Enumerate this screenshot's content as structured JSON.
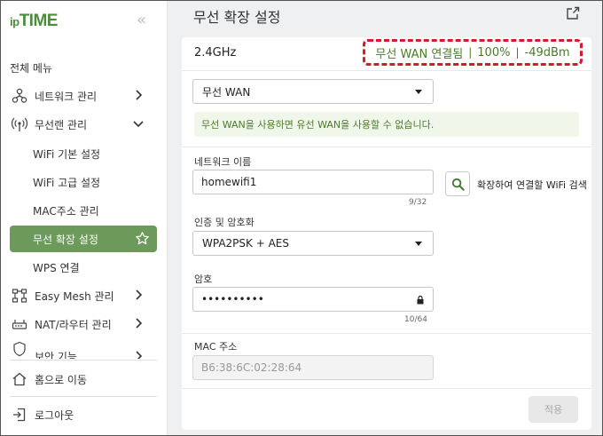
{
  "sidebar": {
    "logo_prefix": "ip",
    "logo_main": "TIME",
    "collapse_glyph": "«",
    "section_title": "전체 메뉴",
    "items": [
      {
        "label": "네트워크 관리",
        "icon": "network-icon"
      },
      {
        "label": "무선랜 관리",
        "icon": "wireless-icon"
      },
      {
        "label": "Easy Mesh 관리",
        "icon": "mesh-icon"
      },
      {
        "label": "NAT/라우터 관리",
        "icon": "router-icon"
      },
      {
        "label": "보안 기능",
        "icon": "security-icon"
      }
    ],
    "sub_items": [
      {
        "label": "WiFi 기본 설정"
      },
      {
        "label": "WiFi 고급 설정"
      },
      {
        "label": "MAC주소 관리"
      },
      {
        "label": "무선 확장 설정",
        "active": true
      },
      {
        "label": "WPS 연결"
      }
    ],
    "home_label": "홈으로 이동",
    "logout_label": "로그아웃"
  },
  "main": {
    "title": "무선 확장 설정",
    "band": "2.4GHz",
    "status": {
      "state": "무선 WAN 연결됨",
      "quality": "100%",
      "signal": "-49dBm",
      "separator": "|"
    },
    "mode_select": {
      "value": "무선 WAN"
    },
    "info_text": "무선 WAN을 사용하면 유선 WAN을 사용할 수 없습니다.",
    "network_name": {
      "label": "네트워크 이름",
      "value": "homewifi1",
      "counter": "9/32"
    },
    "search_text": "확장하여 연결할 WiFi 검색",
    "auth": {
      "label": "인증 및 암호화",
      "value": "WPA2PSK + AES"
    },
    "password": {
      "label": "암호",
      "value": "••••••••••",
      "counter": "10/64"
    },
    "mac": {
      "label": "MAC 주소",
      "value": "B6:38:6C:02:28:64"
    },
    "apply_label": "적용"
  },
  "colors": {
    "brand": "#4b8e3a",
    "active_menu": "#6b9a5a",
    "status_text": "#4a7a2b",
    "highlight_border": "#d11c2c"
  }
}
